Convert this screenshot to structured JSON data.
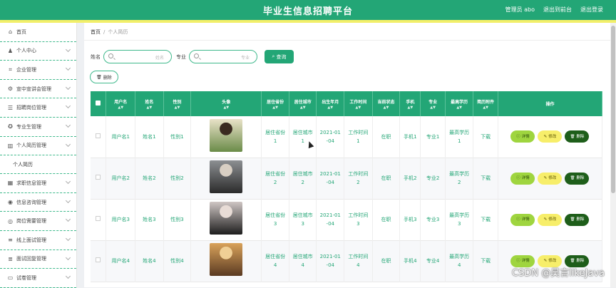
{
  "header": {
    "title": "毕业生信息招聘平台",
    "admin_label": "管理员 abo",
    "back_label": "退出到前台",
    "logout_label": "退出登录"
  },
  "sidebar": {
    "items": [
      {
        "label": "首页",
        "icon": "home-icon",
        "has_chevron": false
      },
      {
        "label": "个人中心",
        "icon": "user-icon",
        "has_chevron": true
      },
      {
        "label": "企业管理",
        "icon": "crop-icon",
        "has_chevron": true
      },
      {
        "label": "宣中宣讲会管理",
        "icon": "settings-icon",
        "has_chevron": true
      },
      {
        "label": "招聘岗位管理",
        "icon": "list-icon",
        "has_chevron": true
      },
      {
        "label": "专业生管理",
        "icon": "badge-icon",
        "has_chevron": true
      },
      {
        "label": "个人简历管理",
        "icon": "chart-icon",
        "has_chevron": true,
        "open": true
      }
    ],
    "sub_item": "个人简历",
    "items_after": [
      {
        "label": "求职信息管理",
        "icon": "grid-icon",
        "has_chevron": true
      },
      {
        "label": "信息咨询管理",
        "icon": "pin-icon",
        "has_chevron": true
      },
      {
        "label": "岗位需要管理",
        "icon": "circle-icon",
        "has_chevron": true
      },
      {
        "label": "线上面试管理",
        "icon": "menu-icon",
        "has_chevron": true
      },
      {
        "label": "面试回复管理",
        "icon": "menu2-icon",
        "has_chevron": true
      },
      {
        "label": "试卷管理",
        "icon": "monitor-icon",
        "has_chevron": true
      }
    ]
  },
  "breadcrumb": {
    "home": "首页",
    "separator": "/",
    "current": "个人简历"
  },
  "search": {
    "name_label": "姓名",
    "name_placeholder": "姓名",
    "major_label": "专业",
    "major_placeholder": "专业",
    "button_label": "查询"
  },
  "delete_button": "删除",
  "table": {
    "headers": [
      "用户名",
      "姓名",
      "性别",
      "头像",
      "居住省份",
      "居住城市",
      "出生年月",
      "工作时间",
      "当前状态",
      "手机",
      "专业",
      "最高学历",
      "简历附件",
      "操作"
    ],
    "sortable": [
      true,
      true,
      true,
      true,
      true,
      true,
      true,
      true,
      true,
      true,
      true,
      true,
      true,
      false
    ],
    "rows": [
      {
        "username": "用户名1",
        "name": "姓名1",
        "gender": "性别1",
        "province": "居住省份\n1",
        "city": "居住城市\n1",
        "birth": "2021-01\n-04",
        "worktime": "工作时间\n1",
        "status": "在职",
        "phone": "手机1",
        "major": "专业1",
        "education": "最高学历\n1",
        "attachment": "下载",
        "photo_colors": [
          "#e9e2c8",
          "#6a8b48",
          "#3a2a20"
        ]
      },
      {
        "username": "用户名2",
        "name": "姓名2",
        "gender": "性别2",
        "province": "居住省份\n2",
        "city": "居住城市\n2",
        "birth": "2021-01\n-04",
        "worktime": "工作时间\n2",
        "status": "在职",
        "phone": "手机2",
        "major": "专业2",
        "education": "最高学历\n2",
        "attachment": "下载",
        "photo_colors": [
          "#8c8f92",
          "#2b2b2b",
          "#d8cfc3"
        ]
      },
      {
        "username": "用户名3",
        "name": "姓名3",
        "gender": "性别3",
        "province": "居住省份\n3",
        "city": "居住城市\n3",
        "birth": "2021-01\n-04",
        "worktime": "工作时间\n3",
        "status": "在职",
        "phone": "手机3",
        "major": "专业3",
        "education": "最高学历\n3",
        "attachment": "下载",
        "photo_colors": [
          "#cfc6c4",
          "#1d1d1d",
          "#e8dcd6"
        ]
      },
      {
        "username": "用户名4",
        "name": "姓名4",
        "gender": "性别4",
        "province": "居住省份\n4",
        "city": "居住城市\n4",
        "birth": "2021-01\n-04",
        "worktime": "工作时间\n4",
        "status": "在职",
        "phone": "手机4",
        "major": "专业4",
        "education": "最高学历\n4",
        "attachment": "下载",
        "photo_colors": [
          "#d9a25a",
          "#5a3a22",
          "#f0cf95"
        ]
      }
    ],
    "actions": {
      "detail": "详情",
      "edit": "修改",
      "delete": "删除"
    }
  },
  "watermark": "CSDN @昊言likeJava",
  "colors": {
    "primary": "#23a676",
    "accent_yellow": "#f2ef6a",
    "detail_btn": "#9fd53f",
    "edit_btn": "#f7ee6a",
    "delete_btn": "#1e5e1a"
  }
}
